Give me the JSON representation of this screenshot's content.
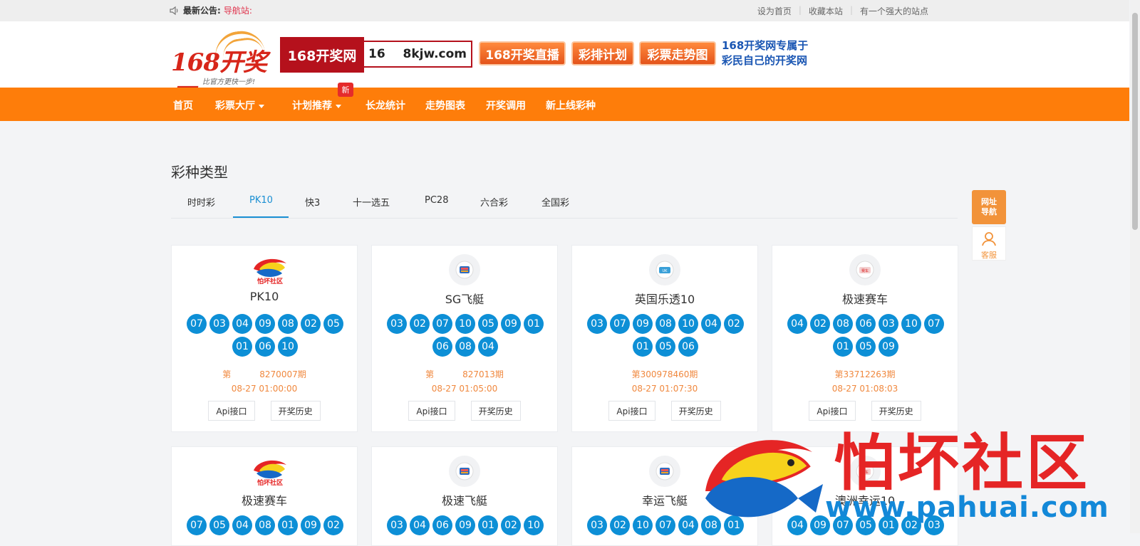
{
  "topbar": {
    "notice_label": "最新公告:",
    "notice_text": "导航站:",
    "links": [
      "设为首页",
      "收藏本站",
      "有一个强大的站点"
    ]
  },
  "header": {
    "logo_text": "168开奖网",
    "logo_slogan": "比官方更快一步!",
    "banner_brand": "168开奖网",
    "banner_url_left": "16",
    "banner_url_right": "8kjw.com",
    "buttons": [
      "168开奖直播",
      "彩排计划",
      "彩票走势图"
    ],
    "tagline_line1": "168开奖网专属于",
    "tagline_line2": "彩民自己的开奖网"
  },
  "nav": {
    "items": [
      "首页",
      "彩票大厅",
      "计划推荐",
      "长龙统计",
      "走势图表",
      "开奖调用",
      "新上线彩种"
    ],
    "new_badge": "新"
  },
  "section": {
    "title": "彩种类型",
    "tabs": [
      "时时彩",
      "PK10",
      "快3",
      "十一选五",
      "PC28",
      "六合彩",
      "全国彩"
    ],
    "active_tab": "PK10"
  },
  "cards": [
    {
      "name": "PK10",
      "icon": "pahuai-logo",
      "balls": [
        "07",
        "03",
        "04",
        "09",
        "08",
        "02",
        "05",
        "01",
        "06",
        "10"
      ],
      "issue_prefix": "第",
      "issue_num": "8270007期",
      "time": "08-27 01:00:00",
      "api": "Api接口",
      "history": "开奖历史"
    },
    {
      "name": "SG飞艇",
      "icon": "boat-icon",
      "balls": [
        "03",
        "02",
        "07",
        "10",
        "05",
        "09",
        "01",
        "06",
        "08",
        "04"
      ],
      "issue_prefix": "第",
      "issue_num": "827013期",
      "time": "08-27 01:05:00",
      "api": "Api接口",
      "history": "开奖历史"
    },
    {
      "name": "英国乐透10",
      "icon": "uk-icon",
      "balls": [
        "03",
        "07",
        "09",
        "08",
        "10",
        "04",
        "02",
        "01",
        "05",
        "06"
      ],
      "issue_prefix": "",
      "issue_num": "第300978460期",
      "time": "08-27 01:07:30",
      "api": "Api接口",
      "history": "开奖历史"
    },
    {
      "name": "极速赛车",
      "icon": "race-icon",
      "balls": [
        "04",
        "02",
        "08",
        "06",
        "03",
        "10",
        "07",
        "01",
        "05",
        "09"
      ],
      "issue_prefix": "",
      "issue_num": "第33712263期",
      "time": "08-27 01:08:03",
      "api": "Api接口",
      "history": "开奖历史"
    },
    {
      "name": "极速赛车",
      "icon": "pahuai-logo",
      "balls": [
        "07",
        "05",
        "04",
        "08",
        "01",
        "09",
        "02"
      ]
    },
    {
      "name": "极速飞艇",
      "icon": "boat-icon",
      "balls": [
        "03",
        "04",
        "06",
        "09",
        "01",
        "02",
        "10"
      ]
    },
    {
      "name": "幸运飞艇",
      "icon": "boat-icon",
      "balls": [
        "03",
        "02",
        "10",
        "07",
        "04",
        "08",
        "01"
      ]
    },
    {
      "name": "澳洲幸运10",
      "icon": "race-icon",
      "balls": [
        "04",
        "09",
        "07",
        "05",
        "01",
        "02",
        "03"
      ]
    }
  ],
  "float": {
    "nav": "网址导航",
    "service": "客服"
  },
  "watermark": {
    "title": "怕坏社区",
    "url": "www.pahuai.com"
  },
  "colors": {
    "nav_orange": "#fe7d0a",
    "ball_blue": "#0d8fd6",
    "issue_orange": "#f0883e",
    "brand_red": "#b5111c"
  }
}
